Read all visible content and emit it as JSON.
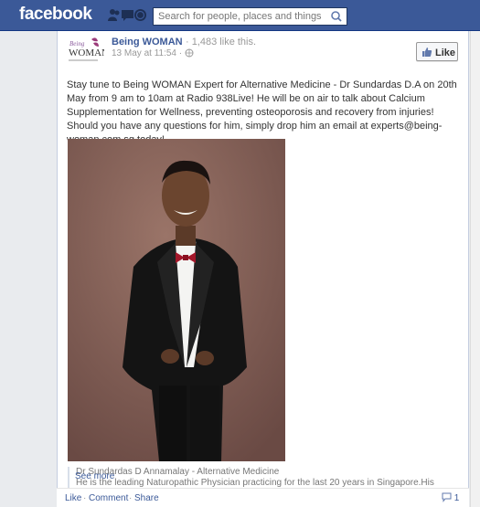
{
  "header": {
    "logo": "facebook",
    "search_placeholder": "Search for people, places and things"
  },
  "post": {
    "page_name": "Being WOMAN",
    "likes_text": "· 1,483 like this.",
    "timestamp": "13 May at 11:54 ·",
    "like_button_label": "Like",
    "avatar_brand": "WOMAN",
    "body_text": "Stay tune to Being WOMAN Expert for Alternative Medicine - Dr Sundardas D.A on 20th May from 9 am to 10am at Radio 938Live! He will be on air to talk about Calcium Supplementation for Wellness, preventing osteoporosis and recovery from injuries! Should you have any questions for him, simply drop him an email at experts@being-woman.com.sg today!",
    "caption_title": "Dr Sundardas D Annamalay - Alternative Medicine",
    "caption_description": "He is the leading Naturopathic Physician practicing for the last 20 years in Singapore.His clinical interests in...",
    "see_more": "See more"
  },
  "actions": {
    "like": "Like",
    "comment": "Comment",
    "share": "Share",
    "comment_count": "1"
  },
  "colors": {
    "brand_blue": "#3b5998",
    "photo_background": "#7a5a52"
  }
}
